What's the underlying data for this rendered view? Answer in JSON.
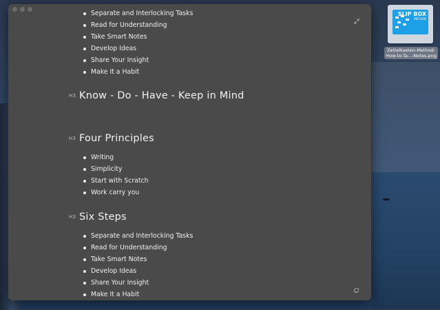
{
  "desktop": {
    "file_icon": {
      "thumbnail_text": "SLIP BOX",
      "thumbnail_subtext": "METHOD",
      "label": "Zettelkasten-Method-How-to-Ta...-Notes.png"
    }
  },
  "window": {
    "top_list": [
      "Separate and Interlocking Tasks",
      "Read for Understanding",
      "Take Smart Notes",
      "Develop Ideas",
      "Share Your Insight",
      "Make It a Habit"
    ],
    "sections": [
      {
        "tag": "H3",
        "title": "Know - Do - Have - Keep in Mind",
        "items": []
      },
      {
        "tag": "H3",
        "title": "Four Principles",
        "items": [
          "Writing",
          "Simplicity",
          "Start with Scratch",
          "Work carry you"
        ]
      },
      {
        "tag": "H3",
        "title": "Six Steps",
        "items": [
          "Separate and Interlocking Tasks",
          "Read for Understanding",
          "Take Smart Notes",
          "Develop Ideas",
          "Share Your Insight",
          "Make It a Habit"
        ]
      }
    ],
    "icons": {
      "collapse": "collapse-icon",
      "sync": "sync-icon"
    }
  }
}
